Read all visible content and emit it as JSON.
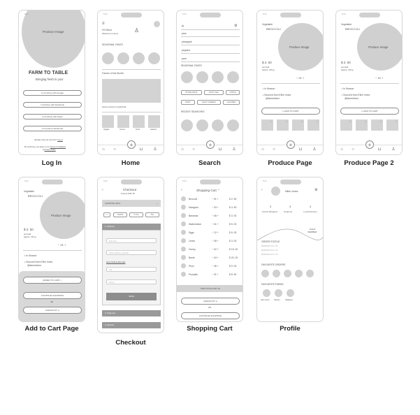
{
  "status_time": "9:41",
  "screens": {
    "login": {
      "caption": "Log In",
      "image_label": "Produce Image",
      "title": "FARM TO TABLE",
      "subtitle": "Bringing fresh to you!",
      "buttons": [
        "Continue with Google",
        "Continue with Facebook",
        "Continue with Apple",
        "Continue with Email"
      ],
      "account_text": "Already have an account?",
      "login_link": "Log In",
      "terms_text": "By continuing, you agree to our",
      "terms_link": "Terms & Conditions",
      "privacy_link": "Privacy Policy",
      "and_text": "&"
    },
    "home": {
      "caption": "Home",
      "greeting": "Hi Nicol",
      "welcome": "Welcome to Home",
      "seasonal": "SEASONAL FAVES",
      "farmer_of_month": "Farmer of the Month",
      "farmer_caption": "Farmer Fendry's Crayfield Ma...",
      "categories": [
        "Veggies",
        "Greens",
        "Fruits",
        "Seafood"
      ]
    },
    "search": {
      "caption": "Search",
      "query": "p|",
      "suggestions": [
        "pear",
        "pineapple",
        "peppers",
        "pear"
      ],
      "seasonal": "SEASONAL FAVES",
      "chips_row1": [
        "STONE FRUIT",
        "ROOT VEG",
        "CITRUS"
      ],
      "chips_row2": [
        "DAIRY",
        "LEAFY GREENS",
        "LEGUMES"
      ],
      "recent": "RECENT SEARCHES"
    },
    "produce": {
      "caption": "Produce Page",
      "category": "Vegetable",
      "name": "BROCCOLI",
      "image_label": "Produce Image",
      "price": "$ 2. 50",
      "unit": "per head",
      "weight": "(approx. 150 g)",
      "qty": "01",
      "in_season": "In Season",
      "sourced": "Sourced from Ellen Innes",
      "farm_handle": "@farmerfarm",
      "add_to_cart": "ADD TO CART"
    },
    "produce2": {
      "caption": "Produce Page 2",
      "category": "Vegetable",
      "name": "BROCCOLI",
      "image_label": "Produce Image",
      "price": "$ 2. 50",
      "unit": "per head",
      "weight": "(approx. 150 g)",
      "qty": "22",
      "in_season": "In Season",
      "sourced": "Sourced from Ellen Innes",
      "farm_handle": "@farmerfarm",
      "add_to_cart": "ADD TO CART"
    },
    "addcart": {
      "caption": "Add to Cart Page",
      "category": "Vegetable",
      "name": "BROCCOLI",
      "image_label": "Produce Image",
      "price": "$ 2. 50",
      "unit": "per head",
      "weight": "(approx. 150 g)",
      "qty": "01",
      "in_season": "In Season",
      "sourced": "Sourced from Ellen Innes",
      "farm_handle": "@farmerfarm",
      "added": "ADDED TO CART",
      "continue": "CONTINUE SHOPPING",
      "or": "OR",
      "checkout": "CHECKOUT"
    },
    "checkout": {
      "caption": "Checkout",
      "title": "Checkout",
      "subtitle": "8 items  $ 58. 50",
      "shipping": "SHIPPING INFO",
      "pay_buttons": [
        "PayPal",
        "G Pay",
        "Pay"
      ],
      "delivery": "1. Delivery",
      "fields": [
        "Full name",
        "Street address, apt/suite",
        "City",
        "Phone"
      ],
      "manual": "Enter Address Manually",
      "save": "SAVE",
      "payment": "2. Payment",
      "review": "3. Review"
    },
    "cart": {
      "caption": "Shopping Cart",
      "title": "Shopping Cart",
      "items": [
        {
          "name": "Broccoli",
          "qty": "01",
          "price": "$ 2. 50"
        },
        {
          "name": "Mangoes",
          "qty": "03",
          "price": "$ 4. 50"
        },
        {
          "name": "Bananas",
          "qty": "06",
          "price": "$ 3. 00"
        },
        {
          "name": "Watermelon",
          "qty": "01",
          "price": "$ 5. 00"
        },
        {
          "name": "Eggs",
          "qty": "12",
          "price": "$ 6. 00"
        },
        {
          "name": "Limes",
          "qty": "06",
          "price": "$ 3. 00"
        },
        {
          "name": "Honey",
          "qty": "02",
          "price": "$ 15. 00"
        },
        {
          "name": "Beets",
          "qty": "04",
          "price": "$ 20. 00"
        },
        {
          "name": "Plum",
          "qty": "06",
          "price": "$ 9. 00"
        },
        {
          "name": "Pumpkin",
          "qty": "01",
          "price": "$ 8. 50"
        }
      ],
      "subtotal": "SUB TOTAL   $ 58. 50",
      "checkout": "CHECKOUT",
      "or": "OR",
      "continue": "CONTINUE SHOPPING"
    },
    "profile": {
      "caption": "Profile",
      "name": "Nikki Jones",
      "stats": [
        {
          "value": "3",
          "label": "Farms Shopped"
        },
        {
          "value": "3",
          "label": "Coupons"
        },
        {
          "value": "4",
          "label": "Local Farmers"
        }
      ],
      "member": "GOLD MEMBER",
      "order_status": "ORDER STATUS",
      "orders": [
        "#0000001  $ 32. 00",
        "#0000002  $ 23. 00",
        "#0000003  $ 12. 50"
      ],
      "fav_orders": "FAVOURITE ORDERS",
      "fav_farms": "FAVOURITE FARMS",
      "farms": [
        "Glen Innes",
        "Oberon",
        "Hellgrove"
      ]
    }
  }
}
